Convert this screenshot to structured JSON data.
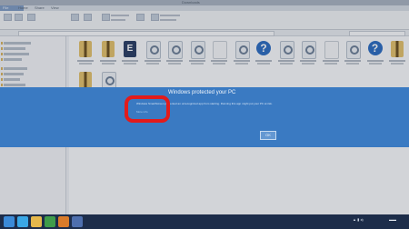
{
  "window": {
    "title": "Downloads"
  },
  "tabs": [
    {
      "label": "File"
    },
    {
      "label": "Home"
    },
    {
      "label": "Share"
    },
    {
      "label": "View"
    }
  ],
  "banner": {
    "heading": "Windows protected your PC",
    "body": "Windows SmartScreen prevented an unrecognized app from starting. Running this app might put your PC at risk.",
    "more_info": "More info",
    "ok_label": "OK"
  },
  "files": [
    {
      "icon": "zip-folder-icon"
    },
    {
      "icon": "zip-folder-icon"
    },
    {
      "icon": "exe-icon",
      "glyph": "E"
    },
    {
      "icon": "magnifier-icon"
    },
    {
      "icon": "magnifier-icon"
    },
    {
      "icon": "magnifier-icon"
    },
    {
      "icon": "blank-file-icon"
    },
    {
      "icon": "magnifier-icon"
    },
    {
      "icon": "help-icon",
      "glyph": "?"
    },
    {
      "icon": "magnifier-icon"
    },
    {
      "icon": "magnifier-icon"
    },
    {
      "icon": "blank-file-icon"
    },
    {
      "icon": "magnifier-icon"
    },
    {
      "icon": "help-icon",
      "glyph": "?"
    },
    {
      "icon": "zip-folder-icon"
    },
    {
      "icon": "zip-folder-icon"
    },
    {
      "icon": "magnifier-icon"
    }
  ],
  "annotation": {
    "color": "#e21b1b"
  },
  "taskbar": {
    "accent": "#1d2d4a",
    "icons": [
      {
        "name": "start-icon",
        "color": "#3b8ad8"
      },
      {
        "name": "ie-icon",
        "color": "#3aa7e6"
      },
      {
        "name": "explorer-icon",
        "color": "#e5b84c"
      },
      {
        "name": "store-icon",
        "color": "#3f9c4a"
      },
      {
        "name": "media-icon",
        "color": "#d97b2a"
      },
      {
        "name": "app-icon",
        "color": "#4e6fae"
      }
    ]
  },
  "colors": {
    "banner": "#3a7ac2",
    "link": "#a9cdf3"
  }
}
